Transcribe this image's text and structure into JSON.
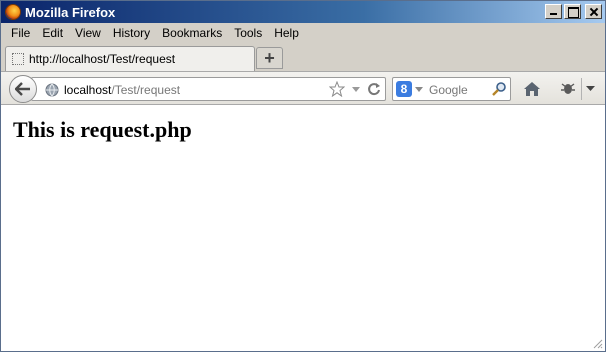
{
  "window": {
    "title": "Mozilla Firefox"
  },
  "menu": [
    "File",
    "Edit",
    "View",
    "History",
    "Bookmarks",
    "Tools",
    "Help"
  ],
  "tab": {
    "title": "http://localhost/Test/request"
  },
  "newtab": {
    "label": "+"
  },
  "urlbar": {
    "host": "localhost",
    "path": "/Test/request"
  },
  "search": {
    "placeholder": "Google",
    "engine_letter": "8"
  },
  "page": {
    "heading": "This is request.php"
  },
  "colors": {
    "titlebar_start": "#0a246a",
    "titlebar_end": "#a6caf0",
    "chrome": "#d4d0c8"
  }
}
